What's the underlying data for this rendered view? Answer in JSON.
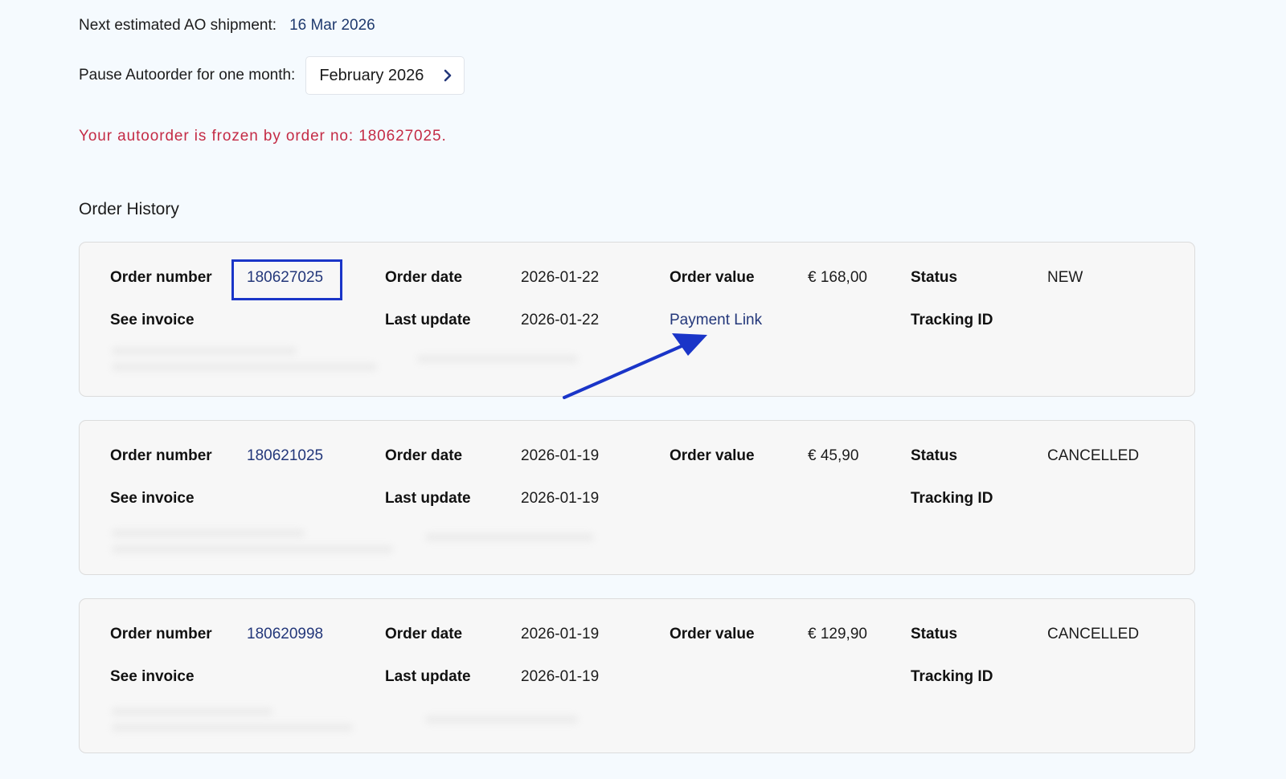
{
  "autoorder": {
    "next_shipment_label": "Next estimated AO shipment:",
    "next_shipment_date": "16 Mar 2026",
    "pause_label": "Pause Autoorder for one month:",
    "pause_month": "February 2026",
    "frozen_message": "Your autoorder is frozen by order no: 180627025."
  },
  "order_history": {
    "title": "Order History",
    "labels": {
      "order_number": "Order number",
      "order_date": "Order date",
      "order_value": "Order value",
      "status": "Status",
      "see_invoice": "See invoice",
      "last_update": "Last update",
      "tracking_id": "Tracking ID"
    },
    "orders": [
      {
        "number": "180627025",
        "date": "2026-01-22",
        "value": "€ 168,00",
        "status": "NEW",
        "last_update": "2026-01-22",
        "payment_link": "Payment Link",
        "tracking_id": ""
      },
      {
        "number": "180621025",
        "date": "2026-01-19",
        "value": "€ 45,90",
        "status": "CANCELLED",
        "last_update": "2026-01-19",
        "tracking_id": ""
      },
      {
        "number": "180620998",
        "date": "2026-01-19",
        "value": "€ 129,90",
        "status": "CANCELLED",
        "last_update": "2026-01-19",
        "tracking_id": ""
      }
    ]
  },
  "colors": {
    "page_background": "#f5fafe",
    "link": "#23377a",
    "alert": "#c42b45",
    "annotation": "#1a35c8"
  },
  "icons": {
    "month_picker": "chevron-right-icon",
    "annotation": "arrow-annotation-icon"
  }
}
